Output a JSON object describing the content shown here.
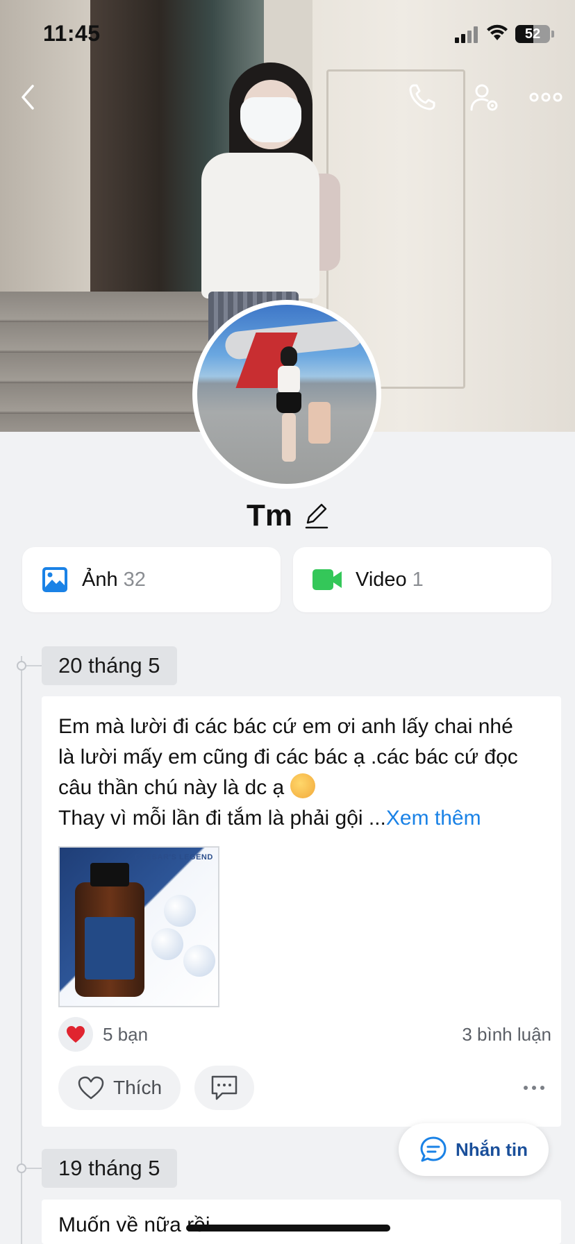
{
  "status_bar": {
    "time": "11:45",
    "battery": "52"
  },
  "profile": {
    "name": "Tm"
  },
  "media": {
    "photos": {
      "label": "Ảnh",
      "count": "32"
    },
    "videos": {
      "label": "Video",
      "count": "1"
    }
  },
  "posts": [
    {
      "date": "20 tháng 5",
      "text_lines": [
        "Em mà lười đi các bác cứ em ơi anh lấy chai nhé",
        "là lười mấy em cũng đi các bác ạ .các bác cứ đọc",
        "câu thần chú này là dc ạ",
        "Thay vì mỗi lần đi tắm là phải gội ..."
      ],
      "see_more": "Xem thêm",
      "image_brand": "CAESAR'S LEGEND",
      "reactions": "5 bạn",
      "comments": "3 bình luận",
      "like_label": "Thích"
    },
    {
      "date": "19 tháng 5",
      "text": "Muốn về nữa rồi"
    }
  ],
  "chat_button": {
    "label": "Nhắn tin"
  },
  "colors": {
    "accent": "#1a82e6",
    "video_green": "#34c759",
    "heart": "#e0242f"
  }
}
